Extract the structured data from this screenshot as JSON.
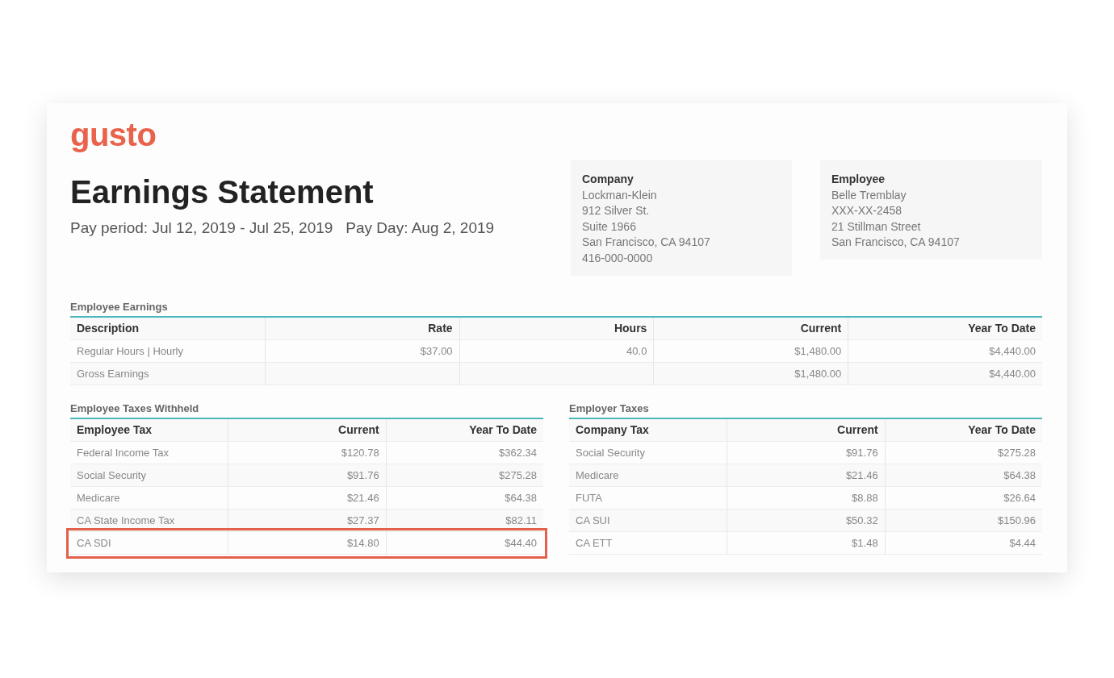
{
  "logo": "gusto",
  "title": "Earnings Statement",
  "pay_period": "Pay period: Jul 12, 2019 - Jul 25, 2019",
  "pay_day": "Pay Day: Aug 2, 2019",
  "parties": [
    {
      "label": "Company",
      "lines": [
        "Lockman-Klein",
        "912 Silver St.",
        "Suite 1966",
        "San Francisco, CA 94107",
        "416-000-0000"
      ]
    },
    {
      "label": "Employee",
      "lines": [
        "Belle Tremblay",
        "XXX-XX-2458",
        "21 Stillman Street",
        "San Francisco, CA 94107"
      ]
    }
  ],
  "earnings": {
    "title": "Employee Earnings",
    "columns": [
      "Description",
      "Rate",
      "Hours",
      "Current",
      "Year To Date"
    ],
    "rows": [
      {
        "cells": [
          "Regular Hours | Hourly",
          "$37.00",
          "40.0",
          "$1,480.00",
          "$4,440.00"
        ],
        "highlighted": false
      },
      {
        "cells": [
          "Gross Earnings",
          "",
          "",
          "$1,480.00",
          "$4,440.00"
        ],
        "highlighted": false
      }
    ]
  },
  "tax_tables": [
    {
      "title": "Employee Taxes Withheld",
      "columns": [
        "Employee Tax",
        "Current",
        "Year To Date"
      ],
      "rows": [
        {
          "cells": [
            "Federal Income Tax",
            "$120.78",
            "$362.34"
          ],
          "highlighted": false
        },
        {
          "cells": [
            "Social Security",
            "$91.76",
            "$275.28"
          ],
          "highlighted": false
        },
        {
          "cells": [
            "Medicare",
            "$21.46",
            "$64.38"
          ],
          "highlighted": false
        },
        {
          "cells": [
            "CA State Income Tax",
            "$27.37",
            "$82.11"
          ],
          "highlighted": false
        },
        {
          "cells": [
            "CA SDI",
            "$14.80",
            "$44.40"
          ],
          "highlighted": true
        }
      ]
    },
    {
      "title": "Employer Taxes",
      "columns": [
        "Company Tax",
        "Current",
        "Year To Date"
      ],
      "rows": [
        {
          "cells": [
            "Social Security",
            "$91.76",
            "$275.28"
          ],
          "highlighted": false
        },
        {
          "cells": [
            "Medicare",
            "$21.46",
            "$64.38"
          ],
          "highlighted": false
        },
        {
          "cells": [
            "FUTA",
            "$8.88",
            "$26.64"
          ],
          "highlighted": false
        },
        {
          "cells": [
            "CA SUI",
            "$50.32",
            "$150.96"
          ],
          "highlighted": false
        },
        {
          "cells": [
            "CA ETT",
            "$1.48",
            "$4.44"
          ],
          "highlighted": false
        }
      ]
    }
  ]
}
